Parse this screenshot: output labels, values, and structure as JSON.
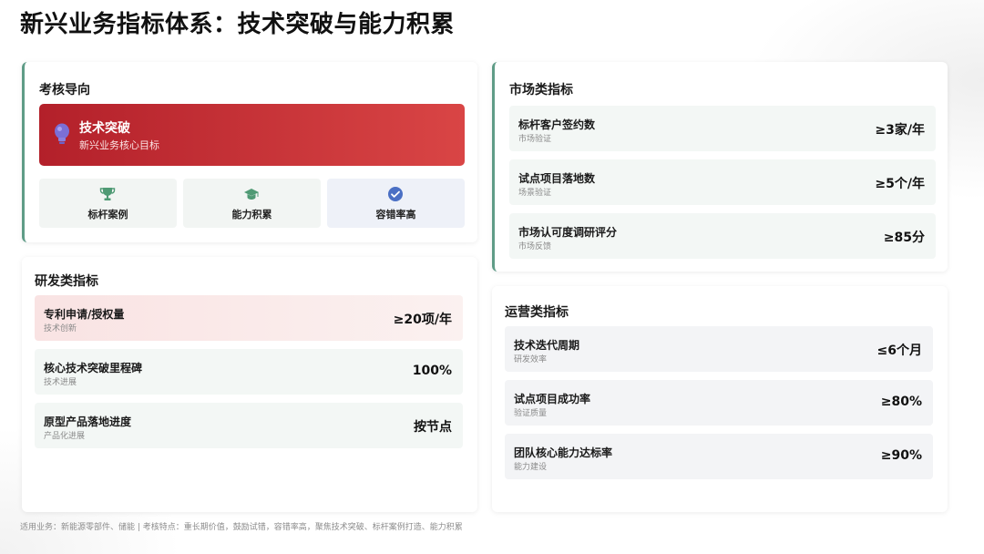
{
  "page": {
    "title": "新兴业务指标体系：技术突破与能力积累",
    "footer": "适用业务：新能源零部件、储能 | 考核特点：重长期价值，鼓励试错，容错率高，聚焦技术突破、标杆案例打造、能力积累"
  },
  "assessment": {
    "title": "考核导向",
    "hero": {
      "label": "技术突破",
      "sub": "新兴业务核心目标",
      "icon": "lightbulb-icon"
    },
    "tiles": [
      {
        "label": "标杆案例",
        "icon": "trophy-icon"
      },
      {
        "label": "能力积累",
        "icon": "graduation-cap-icon"
      },
      {
        "label": "容错率高",
        "icon": "check-circle-icon"
      }
    ]
  },
  "rd": {
    "title": "研发类指标",
    "rows": [
      {
        "label": "专利申请/授权量",
        "sub": "技术创新",
        "value": "≥20项/年"
      },
      {
        "label": "核心技术突破里程碑",
        "sub": "技术进展",
        "value": "100%"
      },
      {
        "label": "原型产品落地进度",
        "sub": "产品化进展",
        "value": "按节点"
      }
    ]
  },
  "market": {
    "title": "市场类指标",
    "rows": [
      {
        "label": "标杆客户签约数",
        "sub": "市场验证",
        "value": "≥3家/年"
      },
      {
        "label": "试点项目落地数",
        "sub": "场景验证",
        "value": "≥5个/年"
      },
      {
        "label": "市场认可度调研评分",
        "sub": "市场反馈",
        "value": "≥85分"
      }
    ]
  },
  "ops": {
    "title": "运营类指标",
    "rows": [
      {
        "label": "技术迭代周期",
        "sub": "研发效率",
        "value": "≤6个月"
      },
      {
        "label": "试点项目成功率",
        "sub": "验证质量",
        "value": "≥80%"
      },
      {
        "label": "团队核心能力达标率",
        "sub": "能力建设",
        "value": "≥90%"
      }
    ]
  },
  "colors": {
    "accent_red": "#c0282f",
    "accent_green": "#5f9c87",
    "icon_blue": "#4a6fc4"
  }
}
